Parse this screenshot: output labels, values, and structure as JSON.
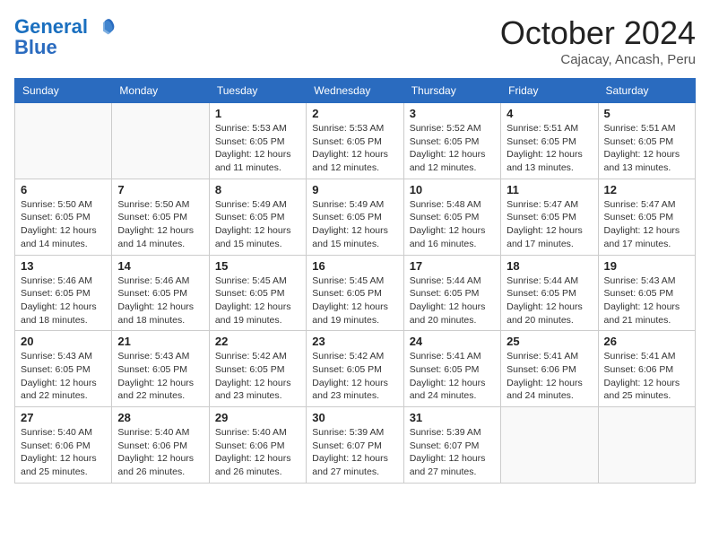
{
  "header": {
    "logo_line1": "General",
    "logo_line2": "Blue",
    "month_title": "October 2024",
    "location": "Cajacay, Ancash, Peru"
  },
  "weekdays": [
    "Sunday",
    "Monday",
    "Tuesday",
    "Wednesday",
    "Thursday",
    "Friday",
    "Saturday"
  ],
  "weeks": [
    [
      {
        "day": "",
        "info": ""
      },
      {
        "day": "",
        "info": ""
      },
      {
        "day": "1",
        "info": "Sunrise: 5:53 AM\nSunset: 6:05 PM\nDaylight: 12 hours\nand 11 minutes."
      },
      {
        "day": "2",
        "info": "Sunrise: 5:53 AM\nSunset: 6:05 PM\nDaylight: 12 hours\nand 12 minutes."
      },
      {
        "day": "3",
        "info": "Sunrise: 5:52 AM\nSunset: 6:05 PM\nDaylight: 12 hours\nand 12 minutes."
      },
      {
        "day": "4",
        "info": "Sunrise: 5:51 AM\nSunset: 6:05 PM\nDaylight: 12 hours\nand 13 minutes."
      },
      {
        "day": "5",
        "info": "Sunrise: 5:51 AM\nSunset: 6:05 PM\nDaylight: 12 hours\nand 13 minutes."
      }
    ],
    [
      {
        "day": "6",
        "info": "Sunrise: 5:50 AM\nSunset: 6:05 PM\nDaylight: 12 hours\nand 14 minutes."
      },
      {
        "day": "7",
        "info": "Sunrise: 5:50 AM\nSunset: 6:05 PM\nDaylight: 12 hours\nand 14 minutes."
      },
      {
        "day": "8",
        "info": "Sunrise: 5:49 AM\nSunset: 6:05 PM\nDaylight: 12 hours\nand 15 minutes."
      },
      {
        "day": "9",
        "info": "Sunrise: 5:49 AM\nSunset: 6:05 PM\nDaylight: 12 hours\nand 15 minutes."
      },
      {
        "day": "10",
        "info": "Sunrise: 5:48 AM\nSunset: 6:05 PM\nDaylight: 12 hours\nand 16 minutes."
      },
      {
        "day": "11",
        "info": "Sunrise: 5:47 AM\nSunset: 6:05 PM\nDaylight: 12 hours\nand 17 minutes."
      },
      {
        "day": "12",
        "info": "Sunrise: 5:47 AM\nSunset: 6:05 PM\nDaylight: 12 hours\nand 17 minutes."
      }
    ],
    [
      {
        "day": "13",
        "info": "Sunrise: 5:46 AM\nSunset: 6:05 PM\nDaylight: 12 hours\nand 18 minutes."
      },
      {
        "day": "14",
        "info": "Sunrise: 5:46 AM\nSunset: 6:05 PM\nDaylight: 12 hours\nand 18 minutes."
      },
      {
        "day": "15",
        "info": "Sunrise: 5:45 AM\nSunset: 6:05 PM\nDaylight: 12 hours\nand 19 minutes."
      },
      {
        "day": "16",
        "info": "Sunrise: 5:45 AM\nSunset: 6:05 PM\nDaylight: 12 hours\nand 19 minutes."
      },
      {
        "day": "17",
        "info": "Sunrise: 5:44 AM\nSunset: 6:05 PM\nDaylight: 12 hours\nand 20 minutes."
      },
      {
        "day": "18",
        "info": "Sunrise: 5:44 AM\nSunset: 6:05 PM\nDaylight: 12 hours\nand 20 minutes."
      },
      {
        "day": "19",
        "info": "Sunrise: 5:43 AM\nSunset: 6:05 PM\nDaylight: 12 hours\nand 21 minutes."
      }
    ],
    [
      {
        "day": "20",
        "info": "Sunrise: 5:43 AM\nSunset: 6:05 PM\nDaylight: 12 hours\nand 22 minutes."
      },
      {
        "day": "21",
        "info": "Sunrise: 5:43 AM\nSunset: 6:05 PM\nDaylight: 12 hours\nand 22 minutes."
      },
      {
        "day": "22",
        "info": "Sunrise: 5:42 AM\nSunset: 6:05 PM\nDaylight: 12 hours\nand 23 minutes."
      },
      {
        "day": "23",
        "info": "Sunrise: 5:42 AM\nSunset: 6:05 PM\nDaylight: 12 hours\nand 23 minutes."
      },
      {
        "day": "24",
        "info": "Sunrise: 5:41 AM\nSunset: 6:05 PM\nDaylight: 12 hours\nand 24 minutes."
      },
      {
        "day": "25",
        "info": "Sunrise: 5:41 AM\nSunset: 6:06 PM\nDaylight: 12 hours\nand 24 minutes."
      },
      {
        "day": "26",
        "info": "Sunrise: 5:41 AM\nSunset: 6:06 PM\nDaylight: 12 hours\nand 25 minutes."
      }
    ],
    [
      {
        "day": "27",
        "info": "Sunrise: 5:40 AM\nSunset: 6:06 PM\nDaylight: 12 hours\nand 25 minutes."
      },
      {
        "day": "28",
        "info": "Sunrise: 5:40 AM\nSunset: 6:06 PM\nDaylight: 12 hours\nand 26 minutes."
      },
      {
        "day": "29",
        "info": "Sunrise: 5:40 AM\nSunset: 6:06 PM\nDaylight: 12 hours\nand 26 minutes."
      },
      {
        "day": "30",
        "info": "Sunrise: 5:39 AM\nSunset: 6:07 PM\nDaylight: 12 hours\nand 27 minutes."
      },
      {
        "day": "31",
        "info": "Sunrise: 5:39 AM\nSunset: 6:07 PM\nDaylight: 12 hours\nand 27 minutes."
      },
      {
        "day": "",
        "info": ""
      },
      {
        "day": "",
        "info": ""
      }
    ]
  ]
}
